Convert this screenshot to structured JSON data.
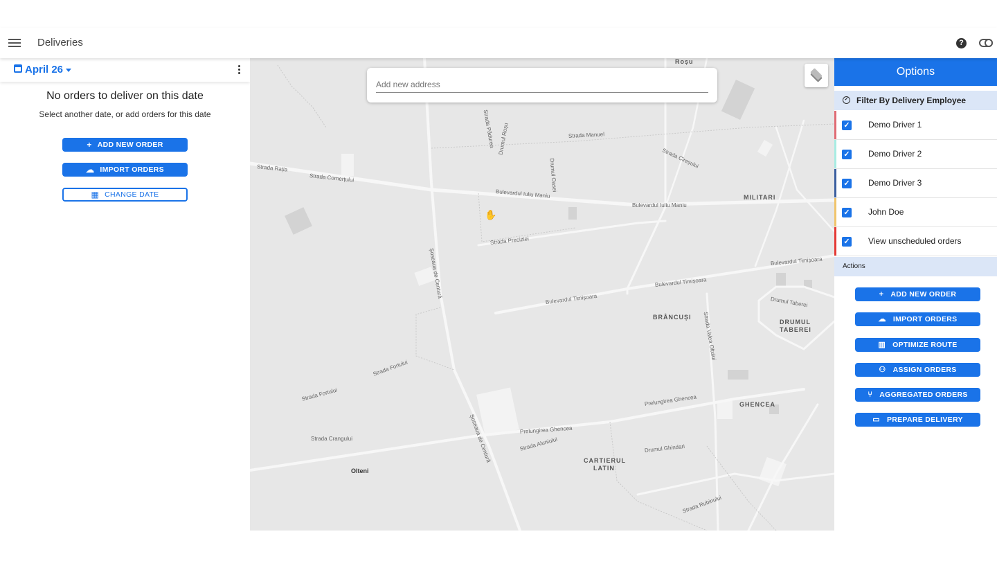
{
  "header": {
    "title": "Deliveries"
  },
  "left_panel": {
    "date_label": "April 26",
    "empty_title": "No orders to deliver on this date",
    "empty_subtitle": "Select another date, or add orders for this date",
    "buttons": {
      "add_new_order": "ADD NEW ORDER",
      "import_orders": "IMPORT ORDERS",
      "change_date": "CHANGE DATE"
    }
  },
  "map": {
    "search_placeholder": "Add new address",
    "labels": {
      "rosu": "Roșu",
      "militari": "MILITARI",
      "brancusi": "BRÂNCUȘI",
      "drumul_taberei_1": "DRUMUL",
      "drumul_taberei_2": "TABEREI",
      "ghencea": "GHENCEA",
      "cartierul_latin_1": "CARTIERUL",
      "cartierul_latin_2": "LATIN",
      "olteni": "Olteni",
      "bd_iuliu_maniu_1": "Bulevardul Iuliu Maniu",
      "bd_iuliu_maniu_2": "Bulevardul Iuliu Maniu",
      "bd_timisoara_1": "Bulevardul Timișoara",
      "bd_timisoara_2": "Bulevardul Timișoara",
      "bd_timisoara_3": "Bulevardul Timișoara",
      "strada_ratia": "Strada Rația",
      "strada_comertului": "Strada Comerțului",
      "strada_preciziei": "Strada Preciziei",
      "soseaua_de_centura_1": "Șoseaua de Centură",
      "soseaua_de_centura_2": "Șoseaua de Centură",
      "prelungirea_ghencea_1": "Prelungirea Ghencea",
      "prelungirea_ghencea_2": "Prelungirea Ghencea",
      "strada_fortului_1": "Strada Fortului",
      "strada_fortului_2": "Strada Fortului",
      "strada_crangului": "Strada Crangului",
      "strada_valea_oltului": "Strada Valea Oltului",
      "drumul_taberei_street": "Drumul Taberei",
      "drumul_oasei": "Drumul Oasei",
      "drumul_rosu": "Drumul Roșu",
      "strada_manuel": "Strada Manuel",
      "strada_ciresului": "Strada Cireșului",
      "strada_padurea": "Strada Pădurea",
      "drumul_ghindari": "Drumul Ghindari",
      "strada_aluniului": "Strada Aluniului",
      "strada_rubinului": "Strada Rubinului"
    }
  },
  "right_panel": {
    "title": "Options",
    "filter_title": "Filter By Delivery Employee",
    "drivers": [
      {
        "name": "Demo Driver 1",
        "color": "#e06b74",
        "checked": true
      },
      {
        "name": "Demo Driver 2",
        "color": "#a8ece3",
        "checked": true
      },
      {
        "name": "Demo Driver 3",
        "color": "#3b5f9f",
        "checked": true
      },
      {
        "name": "John Doe",
        "color": "#f0c46b",
        "checked": true
      },
      {
        "name": "View unscheduled orders",
        "color": "#e53935",
        "checked": true
      }
    ],
    "actions_title": "Actions",
    "actions": {
      "add_new_order": "ADD NEW ORDER",
      "import_orders": "IMPORT ORDERS",
      "optimize_route": "OPTIMIZE ROUTE",
      "assign_orders": "ASSIGN ORDERS",
      "aggregated_orders": "AGGREGATED ORDERS",
      "prepare_delivery": "PREPARE DELIVERY"
    }
  },
  "colors": {
    "primary": "#1a73e8",
    "section_bg": "#dbe6f7",
    "map_bg": "#e7e7e7"
  }
}
